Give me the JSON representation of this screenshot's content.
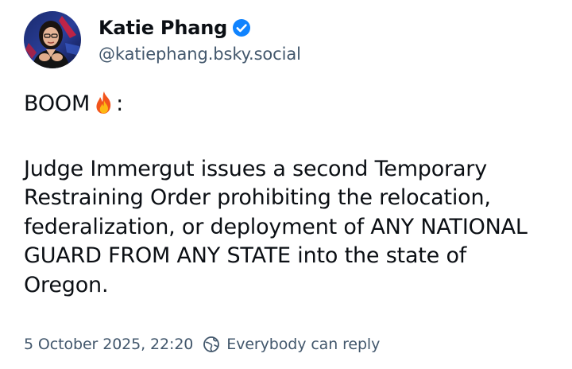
{
  "author": {
    "display_name": "Katie Phang",
    "handle": "@katiephang.bsky.social",
    "verified": true,
    "verified_color": "#1083fe",
    "avatar_icon": "profile-photo"
  },
  "post": {
    "opening": "BOOM",
    "opening_emoji": "fire-emoji",
    "opening_suffix": ":",
    "paragraphs": [
      "Judge Immergut issues a second Temporary Restraining Order prohibiting the relocation, federalization, or deployment of ANY NATIONAL GUARD FROM ANY STATE into the state of Oregon."
    ]
  },
  "meta": {
    "timestamp": "5 October 2025, 22:20",
    "reply_setting_icon": "globe-reply-icon",
    "reply_setting": "Everybody can reply"
  },
  "colors": {
    "text_primary": "#0b0f14",
    "text_secondary": "#42576c",
    "accent": "#1083fe"
  }
}
